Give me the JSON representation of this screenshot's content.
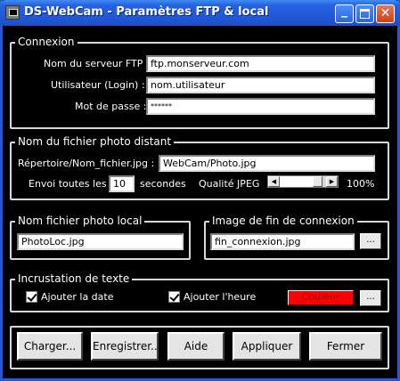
{
  "window": {
    "title": "DS-WebCam - Paramètres FTP & local",
    "title_bar_color": "#2458d8",
    "minimize_icon": "minimize-icon",
    "maximize_icon": "maximize-icon",
    "close_icon": "close-icon"
  },
  "connexion": {
    "legend": "Connexion",
    "server_label": "Nom du serveur FTP :",
    "server_value": "ftp.monserveur.com",
    "user_label": "Utilisateur (Login) :",
    "user_value": "nom.utilisateur",
    "password_label": "Mot de passe :",
    "password_value": "******"
  },
  "remote_photo": {
    "legend": "Nom du fichier photo distant",
    "path_label": "Répertoire/Nom_fichier.jpg :",
    "path_value": "WebCam/Photo.jpg",
    "interval_label": "Envoi toutes les :",
    "interval_value": "10",
    "interval_unit": "secondes",
    "quality_label": "Qualité JPEG",
    "quality_value": "100%",
    "quality_fraction": 1.0
  },
  "local_photo": {
    "legend": "Nom fichier photo local",
    "value": "PhotoLoc.jpg"
  },
  "end_image": {
    "legend": "Image de fin de connexion",
    "value": "fin_connexion.jpg",
    "browse_label": "..."
  },
  "text_overlay": {
    "legend": "Incrustation de texte",
    "add_date_label": "Ajouter la date",
    "add_date_checked": true,
    "add_time_label": "Ajouter l'heure",
    "add_time_checked": true,
    "color_label": "Couleur",
    "color_value": "#ff0000",
    "browse_label": "..."
  },
  "actions": {
    "load": "Charger...",
    "save": "Enregistrer..",
    "help": "Aide",
    "apply": "Appliquer",
    "close": "Fermer"
  }
}
